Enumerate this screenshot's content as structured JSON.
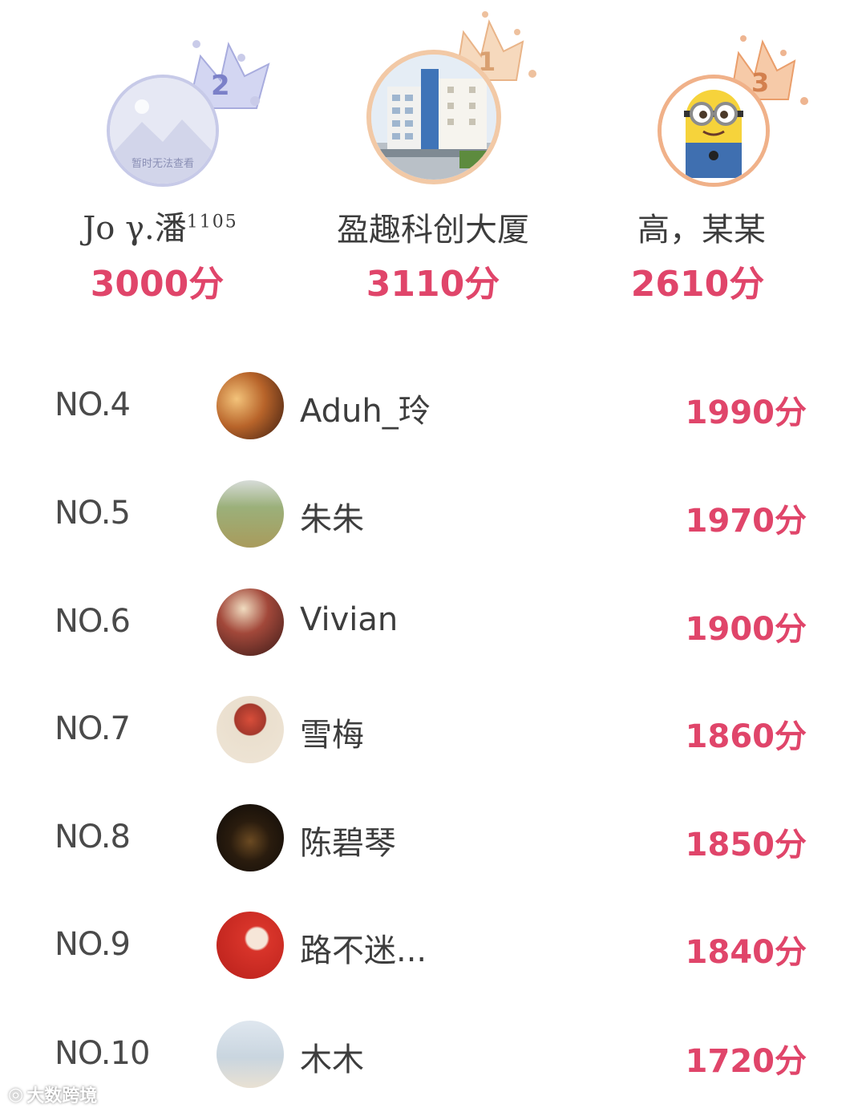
{
  "podium": [
    {
      "rank_label": "2",
      "name": "Jo γ.潘",
      "name_sup": "1105",
      "score": "3000分",
      "placeholder_text": "暂时无法查看",
      "crown_color": "#8b8fd6"
    },
    {
      "rank_label": "1",
      "name": "盈趣科创大厦",
      "name_sup": "",
      "score": "3110分",
      "placeholder_text": "",
      "crown_color": "#f0b88a"
    },
    {
      "rank_label": "3",
      "name": "高，某某",
      "name_sup": "",
      "score": "2610分",
      "placeholder_text": "",
      "crown_color": "#f0a070"
    }
  ],
  "list": [
    {
      "no": "NO.4",
      "name": "Aduh_玲",
      "score": "1990分"
    },
    {
      "no": "NO.5",
      "name": "朱朱",
      "score": "1970分"
    },
    {
      "no": "NO.6",
      "name": "Vivian",
      "score": "1900分"
    },
    {
      "no": "NO.7",
      "name": "雪梅",
      "score": "1860分"
    },
    {
      "no": "NO.8",
      "name": "陈碧琴",
      "score": "1850分"
    },
    {
      "no": "NO.9",
      "name": "路不迷...",
      "score": "1840分"
    },
    {
      "no": "NO.10",
      "name": "木木",
      "score": "1720分"
    }
  ],
  "watermark": {
    "text": "大数跨境"
  },
  "colors": {
    "score": "#e0456a",
    "rank_2_crown": "#8b8fd6",
    "rank_1_crown": "#f0b88a",
    "rank_3_crown": "#f0a070"
  }
}
